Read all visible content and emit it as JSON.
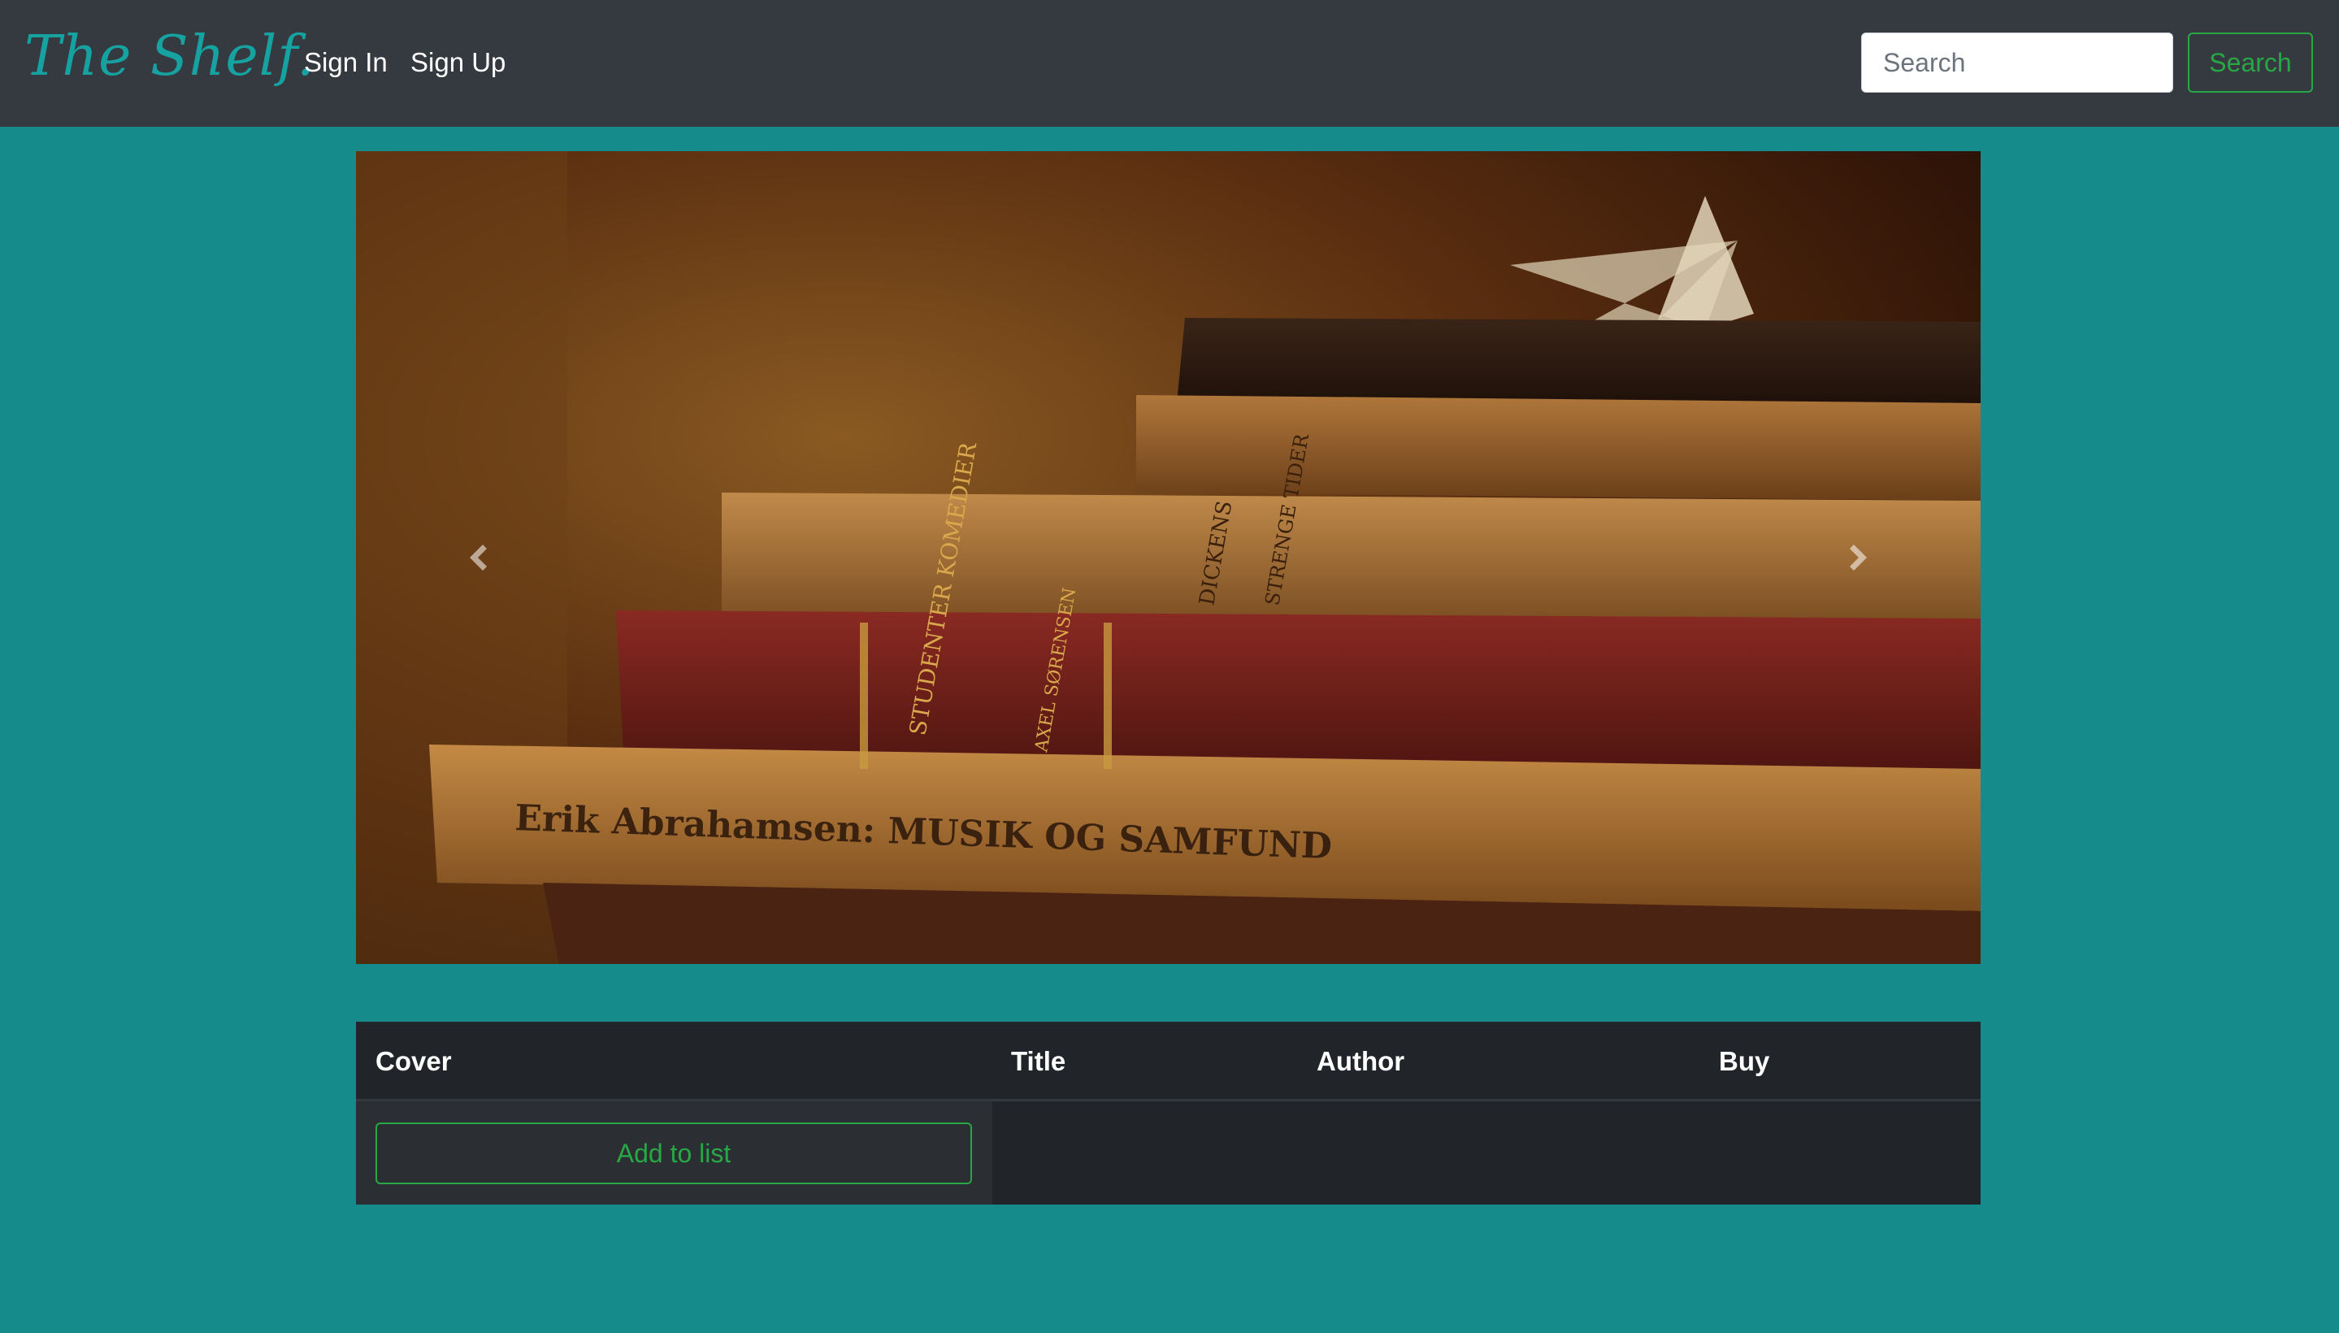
{
  "navbar": {
    "brand": "The Shelf.",
    "links": [
      "Sign In",
      "Sign Up"
    ],
    "search_placeholder": "Search",
    "search_button": "Search"
  },
  "carousel": {
    "slide_image": "stack-of-old-books",
    "book_spines": [
      "Erik Abrahamsen: MUSIK OG SAMFUND",
      "STUDENTER KOMEDIER",
      "AXEL SØRENSEN",
      "DICKENS",
      "STRENGE TIDER"
    ],
    "prev_icon": "chevron-left-icon",
    "next_icon": "chevron-right-icon"
  },
  "table": {
    "headers": [
      "Cover",
      "Title",
      "Author",
      "Buy"
    ],
    "rows": [
      {
        "action_label": "Add to list"
      }
    ]
  },
  "colors": {
    "background": "#158b8b",
    "navbar": "#343a40",
    "brand": "#17a2a2",
    "success": "#28a745",
    "table_dark": "#212529"
  }
}
